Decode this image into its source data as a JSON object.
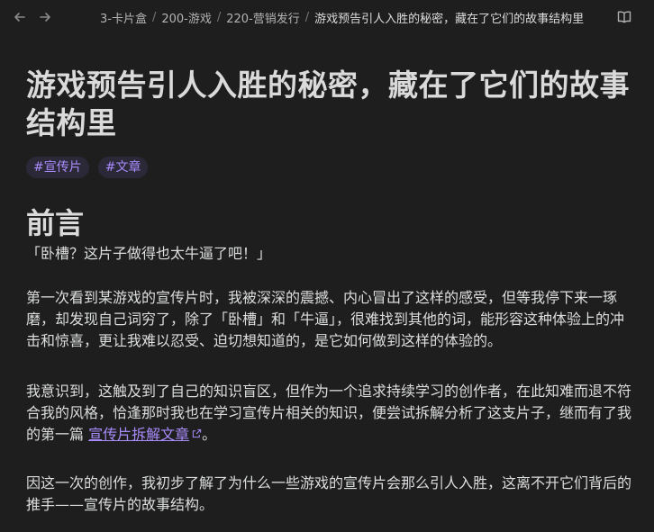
{
  "nav": {
    "back_icon": "arrow-left-icon",
    "forward_icon": "arrow-right-icon"
  },
  "breadcrumb": [
    "3-卡片盒",
    "200-游戏",
    "220-营销发行",
    "游戏预告引人入胜的秘密，藏在了它们的故事结构里"
  ],
  "header": {
    "reading_mode_icon": "book-open-icon"
  },
  "page": {
    "title": "游戏预告引人入胜的秘密，藏在了它们的故事结构里",
    "tags": [
      "#宣传片",
      "#文章"
    ],
    "heading": "前言",
    "quote": "「卧槽？这片子做得也太牛逼了吧！」",
    "p1": "第一次看到某游戏的宣传片时，我被深深的震撼、内心冒出了这样的感受，但等我停下来一琢磨，却发现自己词穷了，除了「卧槽」和「牛逼」，很难找到其他的词，能形容这种体验上的冲击和惊喜，更让我难以忍受、迫切想知道的，是它如何做到这样的体验的。",
    "p2_before": "我意识到，这触及到了自己的知识盲区，但作为一个追求持续学习的创作者，在此知难而退不符合我的风格，恰逢那时我也在学习宣传片相关的知识，便尝试拆解分析了这支片子，继而有了我的第一篇 ",
    "p2_link": "宣传片拆解文章",
    "p2_after": "。",
    "p3": "因这一次的创作，我初步了解了为什么一些游戏的宣传片会那么引人入胜，这离不开它们背后的推手——宣传片的故事结构。"
  },
  "colors": {
    "background": "#1e1e1e",
    "text": "#dcddde",
    "accent": "#a88bfa",
    "tag_bg": "#2b2838"
  }
}
